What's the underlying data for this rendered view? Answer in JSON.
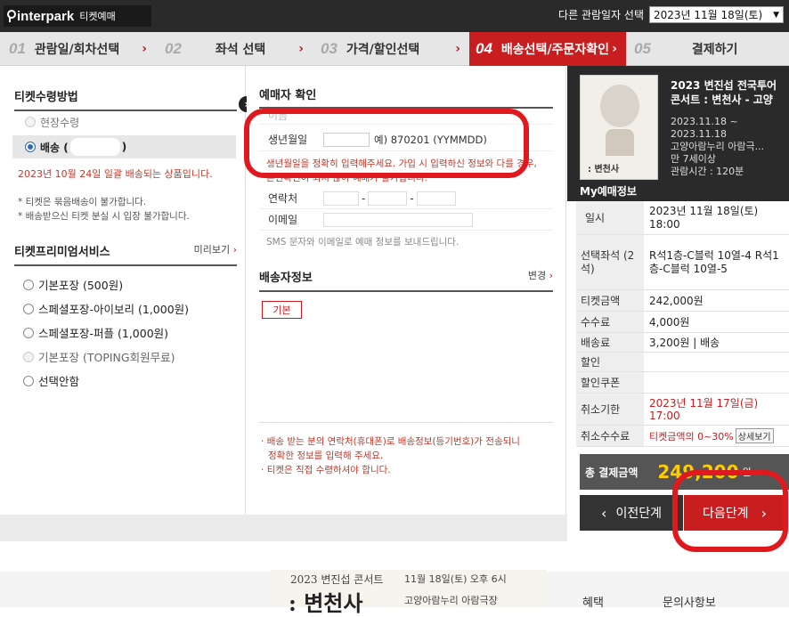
{
  "header": {
    "logo_brand": "interpark",
    "logo_sub": "티켓예매",
    "date_label": "다른 관람일자 선택",
    "date_value": "2023년 11월 18일(토)"
  },
  "steps": [
    {
      "num": "01",
      "label": "관람일/회차선택"
    },
    {
      "num": "02",
      "label": "좌석 선택"
    },
    {
      "num": "03",
      "label": "가격/할인선택"
    },
    {
      "num": "04",
      "label": "배송선택/주문자확인"
    },
    {
      "num": "05",
      "label": "결제하기"
    }
  ],
  "left": {
    "receipt_title": "티켓수령방법",
    "option_onsite": "현장수령",
    "option_delivery": "배송 (",
    "option_delivery_end": ")",
    "delivery_note": "2023년 10월 24일 일괄 배송되는 상품입니다.",
    "note1": "* 티켓은 묶음배송이 불가합니다.",
    "note2": "* 배송받으신 티켓 분실 시 입장 불가합니다.",
    "premium_title": "티켓프리미엄서비스",
    "preview": "미리보기",
    "premium_options": [
      "기본포장 (500원)",
      "스페셜포장-아이보리 (1,000원)",
      "스페셜포장-퍼플 (1,000원)",
      "기본포장 (TOPING회원무료)",
      "선택안함"
    ]
  },
  "middle": {
    "buyer_title": "예매자 확인",
    "name_label": "이름",
    "birth_label": "생년월일",
    "birth_hint": "예) 870201 (YYMMDD)",
    "birth_warn1": "생년월일을 정확히 입력해주세요. 가입 시 입력하신 정보와 다를 경우,",
    "birth_warn2": "본인확인이 되지 않아 예매가 불가합니다.",
    "phone_label": "연락처",
    "email_label": "이메일",
    "sms_note": "SMS 문자와 이메일로 예매 정보를 보내드립니다.",
    "shipping_title": "배송자정보",
    "change": "변경",
    "default_btn": "기본",
    "bottom_note1": "배송 받는 분의 연락처(휴대폰)로 배송정보(등기번호)가 전송되니",
    "bottom_note1b": "정확한 정보를 입력해 주세요.",
    "bottom_note2": "티켓은 직접 수령하셔야 합니다."
  },
  "right": {
    "concert_title": "2023 변진섭 전국투어 콘서트 : 변천사 - 고양",
    "date_range1": "2023.11.18 ~",
    "date_range2": "2023.11.18",
    "venue": "고양아람누리 아람극...",
    "age": "만 7세이상",
    "runtime": "관람시간 : 120분",
    "myinfo_title": "My예매정보",
    "rows": [
      {
        "k": "일시",
        "v": "2023년 11월 18일(토) 18:00"
      },
      {
        "k": "선택좌석 (2석)",
        "v": "R석1층-C블럭 10열-4 R석1층-C블럭 10열-5"
      },
      {
        "k": "티켓금액",
        "v": "242,000원"
      },
      {
        "k": "수수료",
        "v": "4,000원"
      },
      {
        "k": "배송료",
        "v": "3,200원 | 배송"
      },
      {
        "k": "할인",
        "v": ""
      },
      {
        "k": "할인쿠폰",
        "v": ""
      },
      {
        "k": "취소기한",
        "v": "2023년 11월 17일(금) 17:00"
      },
      {
        "k": "취소수수료",
        "v": "티켓금액의 0~30%"
      }
    ],
    "detail_btn": "상세보기",
    "total_label": "총 결제금액",
    "total_value": "249,200",
    "total_unit": "원",
    "prev_btn": "이전단계",
    "next_btn": "다음단계"
  },
  "poster": {
    "line1": "2023 변진섭 콘서트",
    "line2": "11월 18일(토) 오후 6시",
    "big": ": 변천사",
    "venue": "고양아람누리 아람극장",
    "tab1": "혜택",
    "tab2": "문의사항보"
  },
  "colors": {
    "accent": "#c81e20",
    "dark": "#2a2a2a",
    "annotation": "#e0191e"
  }
}
